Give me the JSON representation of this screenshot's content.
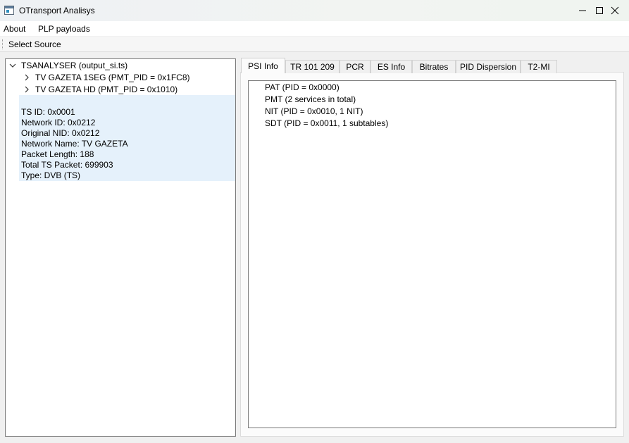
{
  "window": {
    "title": "OTransport Analisys",
    "minimize_icon": "minimize-icon",
    "maximize_icon": "maximize-icon",
    "close_icon": "close-icon"
  },
  "menu": {
    "items": [
      {
        "label": "About"
      },
      {
        "label": "PLP payloads"
      }
    ]
  },
  "toolbar": {
    "select_source_label": "Select Source"
  },
  "tree": {
    "root_label": "TSANALYSER (output_si.ts)",
    "children": [
      {
        "label": "TV GAZETA 1SEG (PMT_PID = 0x1FC8)"
      },
      {
        "label": "TV GAZETA HD (PMT_PID = 0x1010)"
      }
    ],
    "info_lines": [
      "TS ID: 0x0001",
      "Network ID: 0x0212",
      "Original NID: 0x0212",
      "Network Name: TV GAZETA",
      "Packet Length: 188",
      "Total TS Packet: 699903",
      "Type: DVB (TS)"
    ]
  },
  "tabs": [
    {
      "label": "PSI Info",
      "active": true
    },
    {
      "label": "TR 101 209",
      "active": false
    },
    {
      "label": "PCR",
      "active": false
    },
    {
      "label": "ES Info",
      "active": false
    },
    {
      "label": "Bitrates",
      "active": false
    },
    {
      "label": "PID Dispersion",
      "active": false
    },
    {
      "label": "T2-MI",
      "active": false
    }
  ],
  "psi_info": {
    "lines": [
      "PAT (PID = 0x0000)",
      "PMT (2 services in total)",
      "NIT (PID = 0x0010, 1 NIT)",
      "SDT (PID = 0x0011, 1 subtables)"
    ]
  },
  "colors": {
    "selection_background": "#e5f1fb",
    "panel_border": "#7a7a7a"
  }
}
